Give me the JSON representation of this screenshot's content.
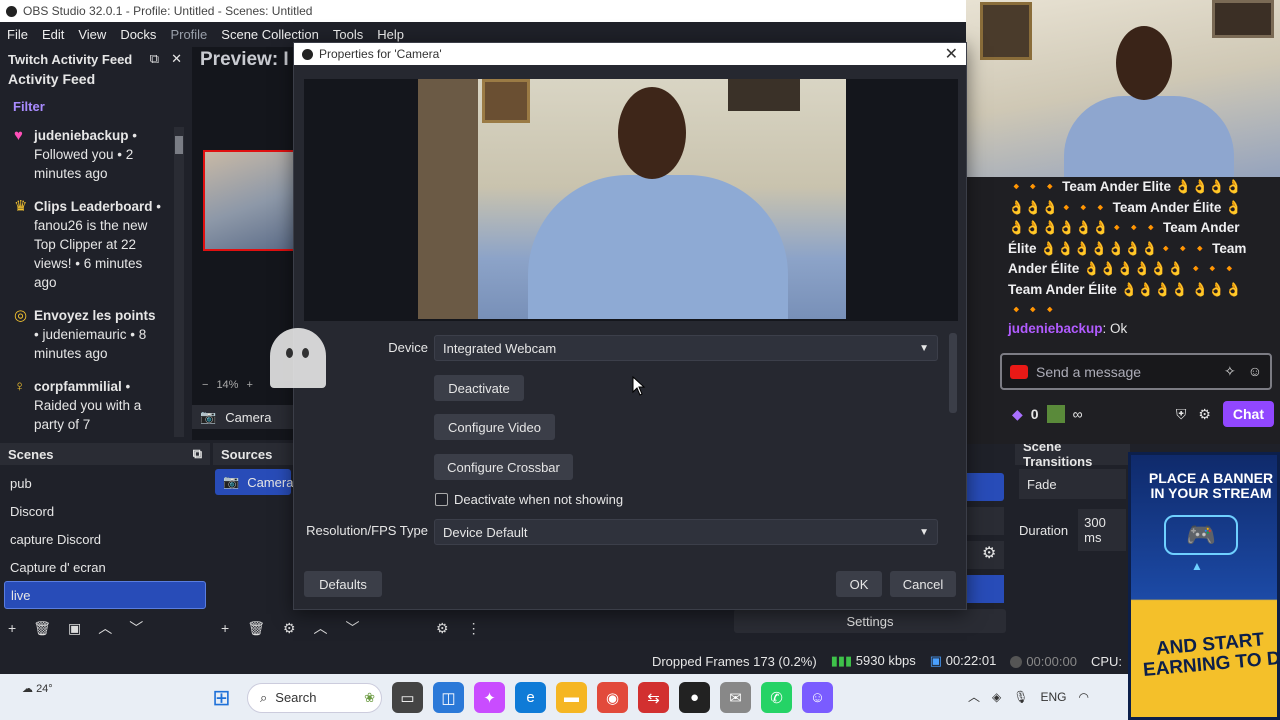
{
  "window": {
    "title": "OBS Studio 32.0.1 - Profile: Untitled - Scenes: Untitled"
  },
  "menu": [
    "File",
    "Edit",
    "View",
    "Docks",
    "Profile",
    "Scene Collection",
    "Tools",
    "Help"
  ],
  "feed": {
    "title": "Twitch Activity Feed",
    "subtitle": "Activity Feed",
    "filter": "Filter",
    "items": [
      {
        "user": "judeniebackup",
        "text": " • Followed you • 2 minutes ago"
      },
      {
        "user": "Clips Leaderboard",
        "text": " • fanou26 is the new Top Clipper at 22 views! • 6 minutes ago"
      },
      {
        "user": "Envoyez les points",
        "text": " • judeniemauric • 8 minutes ago"
      },
      {
        "user": "corpfammilial",
        "text": " • Raided you with a party of 7"
      }
    ]
  },
  "preview": {
    "label": "Preview: I",
    "zoom": "14%",
    "source": "Camera"
  },
  "scenes": {
    "title": "Scenes",
    "items": [
      "pub",
      "Discord",
      "capture Discord",
      "Capture d' ecran",
      "live"
    ],
    "selected": 4
  },
  "sources": {
    "title": "Sources",
    "items": [
      "Camera"
    ]
  },
  "controls": {
    "settings": "Settings"
  },
  "transitions": {
    "title": "Scene Transitions",
    "type": "Fade",
    "duration_label": "Duration",
    "duration": "300 ms"
  },
  "status": {
    "dropped": "Dropped Frames 173 (0.2%)",
    "bitrate": "5930 kbps",
    "live_time": "00:22:01",
    "rec_time": "00:00:00",
    "cpu": "CPU:"
  },
  "dialog": {
    "title": "Properties for 'Camera'",
    "device_label": "Device",
    "device_value": "Integrated Webcam",
    "deactivate": "Deactivate",
    "configure_video": "Configure Video",
    "configure_crossbar": "Configure Crossbar",
    "deactivate_when_hidden": "Deactivate when not showing",
    "resolution_label": "Resolution/FPS Type",
    "resolution_value": "Device Default",
    "defaults": "Defaults",
    "ok": "OK",
    "cancel": "Cancel"
  },
  "chat": {
    "spam": "🔸🔸🔸 Team Ander Elite 👌👌👌👌 👌👌👌🔸🔸🔸 Team Ander Élite 👌 👌👌👌👌👌👌🔸🔸🔸 Team Ander Élite 👌👌👌👌👌👌👌🔸🔸🔸 Team Ander Élite 👌👌👌👌👌👌 🔸🔸🔸 Team Ander Élite 👌👌👌👌 👌👌👌🔸🔸🔸",
    "user": "judeniebackup",
    "reply": ": Ok",
    "placeholder": "Send a message",
    "points": "0",
    "infinity": "∞",
    "chat_button": "Chat"
  },
  "ad": {
    "line1": "PLACE A BANNER IN YOUR STREAM",
    "line2": "AND START EARNING TO",
    "tail": "D"
  },
  "taskbar": {
    "weather": "24°",
    "search": "Search",
    "lang": "ENG"
  }
}
